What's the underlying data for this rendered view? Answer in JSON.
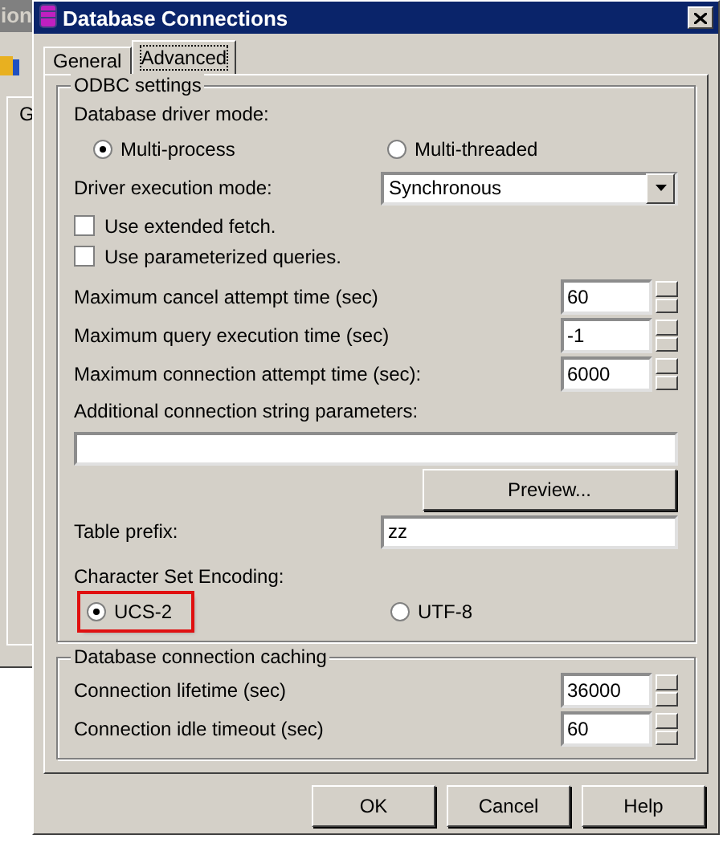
{
  "background_window": {
    "title": "ion",
    "tab": "G"
  },
  "window": {
    "title": "Database Connections"
  },
  "tabs": [
    {
      "label": "General",
      "selected": false
    },
    {
      "label": "Advanced",
      "selected": true
    }
  ],
  "odbc_group": {
    "title": "ODBC settings",
    "driver_mode_label": "Database driver mode:",
    "driver_modes": [
      {
        "label": "Multi-process",
        "selected": true
      },
      {
        "label": "Multi-threaded",
        "selected": false
      }
    ],
    "execution_mode": {
      "label": "Driver execution mode:",
      "value": "Synchronous"
    },
    "checkboxes": [
      {
        "label": "Use extended fetch.",
        "checked": false
      },
      {
        "label": "Use parameterized queries.",
        "checked": false
      }
    ],
    "spinners": [
      {
        "label": "Maximum cancel attempt time (sec)",
        "value": "60"
      },
      {
        "label": "Maximum query execution time (sec)",
        "value": "-1"
      },
      {
        "label": "Maximum connection attempt time (sec):",
        "value": "6000"
      }
    ],
    "connection_string": {
      "label": "Additional connection string parameters:"
    },
    "preview_button": "Preview...",
    "table_prefix": {
      "label": "Table prefix:",
      "value": "zz"
    },
    "encoding": {
      "label": "Character Set Encoding:",
      "options": [
        {
          "label": "UCS-2",
          "selected": true,
          "highlighted": true
        },
        {
          "label": "UTF-8",
          "selected": false,
          "highlighted": false
        }
      ]
    }
  },
  "caching_group": {
    "title": "Database connection caching",
    "spinners": [
      {
        "label": "Connection lifetime (sec)",
        "value": "36000"
      },
      {
        "label": "Connection idle timeout (sec)",
        "value": "60"
      }
    ]
  },
  "buttons": [
    "OK",
    "Cancel",
    "Help"
  ]
}
